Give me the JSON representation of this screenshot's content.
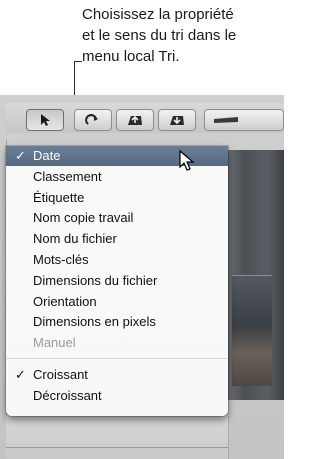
{
  "callout": {
    "lines": [
      "Choisissez la propriété",
      "et le sens du tri dans le",
      "menu local Tri."
    ]
  },
  "toolbar": {
    "buttons": [
      {
        "name": "select-tool",
        "icon": "arrow-pointer-icon"
      },
      {
        "name": "rotate-tool",
        "icon": "rotate-icon"
      },
      {
        "name": "lift-tool",
        "icon": "lift-icon"
      },
      {
        "name": "stamp-tool",
        "icon": "stamp-icon"
      },
      {
        "name": "straighten-tool",
        "icon": "straighten-icon"
      }
    ]
  },
  "sort_menu": {
    "properties": [
      {
        "label": "Date",
        "checked": true,
        "highlighted": true,
        "enabled": true
      },
      {
        "label": "Classement",
        "checked": false,
        "highlighted": false,
        "enabled": true
      },
      {
        "label": "Étiquette",
        "checked": false,
        "highlighted": false,
        "enabled": true
      },
      {
        "label": "Nom copie travail",
        "checked": false,
        "highlighted": false,
        "enabled": true
      },
      {
        "label": "Nom du fichier",
        "checked": false,
        "highlighted": false,
        "enabled": true
      },
      {
        "label": "Mots-clés",
        "checked": false,
        "highlighted": false,
        "enabled": true
      },
      {
        "label": "Dimensions du fichier",
        "checked": false,
        "highlighted": false,
        "enabled": true
      },
      {
        "label": "Orientation",
        "checked": false,
        "highlighted": false,
        "enabled": true
      },
      {
        "label": "Dimensions en pixels",
        "checked": false,
        "highlighted": false,
        "enabled": true
      },
      {
        "label": "Manuel",
        "checked": false,
        "highlighted": false,
        "enabled": false
      }
    ],
    "order": [
      {
        "label": "Croissant",
        "checked": true
      },
      {
        "label": "Décroissant",
        "checked": false
      }
    ],
    "check_glyph": "✓"
  },
  "colors": {
    "highlight": "#5f7390",
    "menu_bg": "#fafafa",
    "disabled_text": "#9a9a9a"
  }
}
